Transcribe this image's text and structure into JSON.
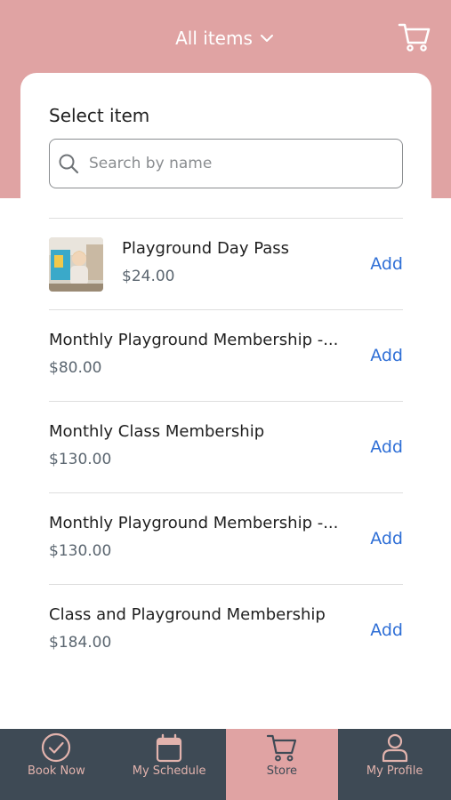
{
  "header": {
    "title": "All items",
    "bg_color": "#e0a3a3",
    "icons": [
      "chevron-down-icon",
      "cart-icon"
    ]
  },
  "card": {
    "title": "Select item",
    "search_placeholder": "Search by name",
    "search_value": ""
  },
  "items": [
    {
      "name": "Playground Day Pass",
      "price": "$24.00",
      "add_label": "Add",
      "has_thumbnail": true
    },
    {
      "name": "Monthly Playground Membership -...",
      "price": "$80.00",
      "add_label": "Add",
      "has_thumbnail": false
    },
    {
      "name": "Monthly Class Membership",
      "price": "$130.00",
      "add_label": "Add",
      "has_thumbnail": false
    },
    {
      "name": "Monthly Playground Membership -...",
      "price": "$130.00",
      "add_label": "Add",
      "has_thumbnail": false
    },
    {
      "name": "Class and Playground Membership",
      "price": "$184.00",
      "add_label": "Add",
      "has_thumbnail": false
    }
  ],
  "nav": {
    "items": [
      {
        "label": "Book Now",
        "icon": "check-circle-icon",
        "active": false
      },
      {
        "label": "My Schedule",
        "icon": "calendar-icon",
        "active": false
      },
      {
        "label": "Store",
        "icon": "cart-icon",
        "active": true
      },
      {
        "label": "My Profile",
        "icon": "person-icon",
        "active": false
      }
    ],
    "bg_color": "#3e4a55",
    "active_color": "#e0a3a3",
    "accent_color": "#2f6fd6"
  }
}
